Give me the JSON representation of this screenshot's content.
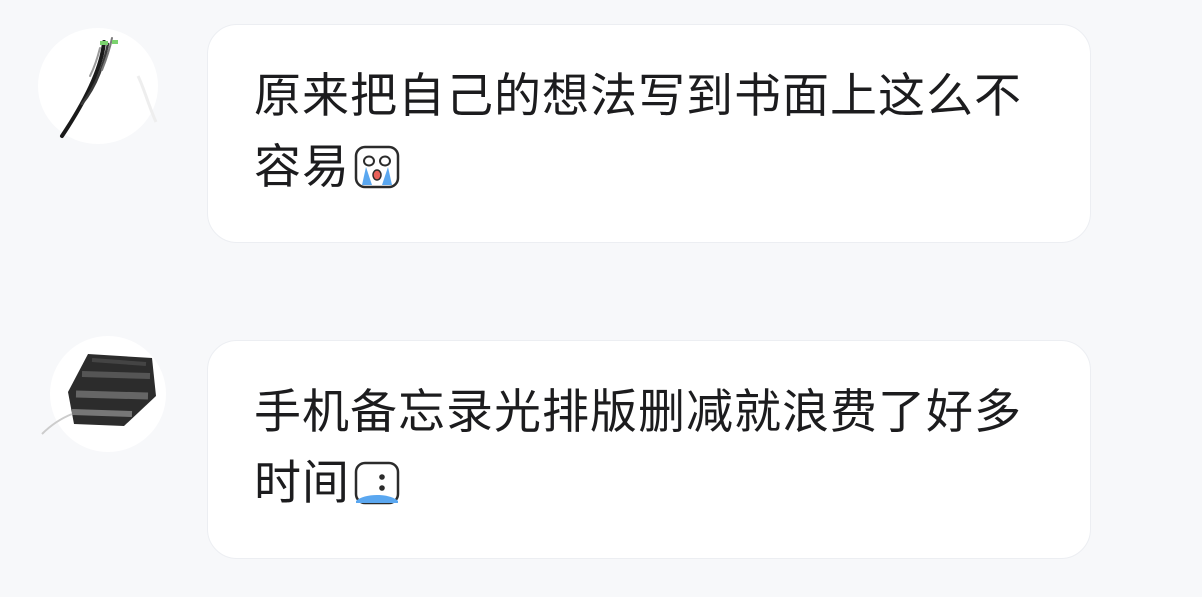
{
  "messages": [
    {
      "text": "原来把自己的想法写到书面上这么不容易",
      "emoji": "crying-face-icon"
    },
    {
      "text": "手机备忘录光排版删减就浪费了好多时间",
      "emoji": "tearful-face-icon"
    }
  ],
  "colors": {
    "background": "#f7f8fa",
    "bubble": "#ffffff",
    "bubble_border": "#eceef2",
    "text": "#1c1c1e",
    "tear_blue": "#5aa7f0"
  }
}
